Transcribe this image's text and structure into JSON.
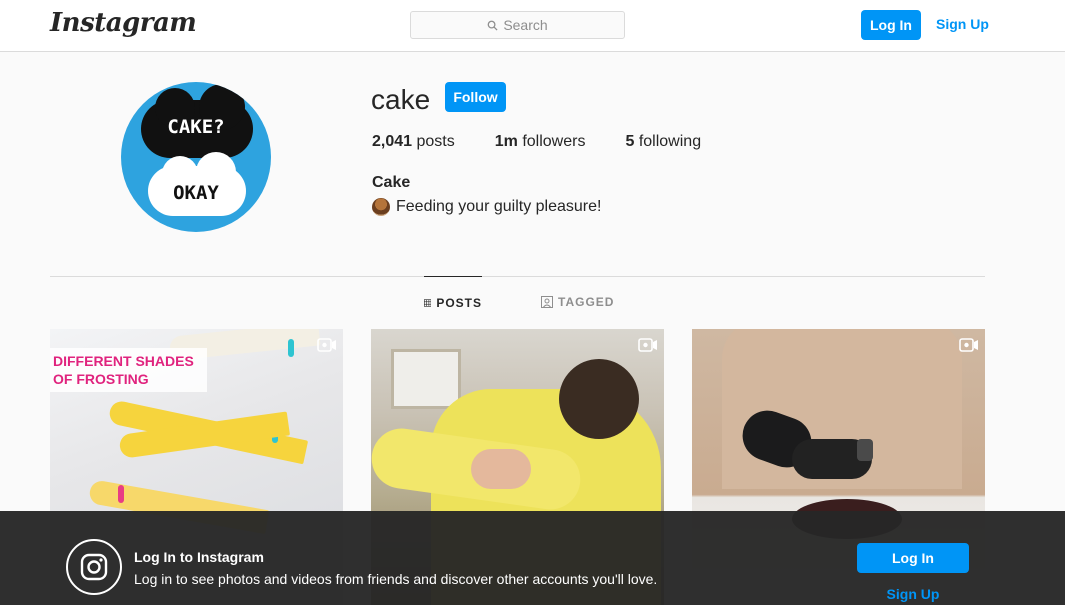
{
  "header": {
    "logo": "Instagram",
    "search_placeholder": "Search",
    "login_label": "Log In",
    "signup_label": "Sign Up"
  },
  "profile": {
    "avatar_top_text": "CAKE?",
    "avatar_bottom_text": "OKAY",
    "username": "cake",
    "follow_label": "Follow",
    "stats": [
      {
        "value": "2,041",
        "label": "posts"
      },
      {
        "value": "1m",
        "label": "followers"
      },
      {
        "value": "5",
        "label": "following"
      }
    ],
    "full_name": "Cake",
    "bio": "Feeding your guilty pleasure!",
    "bio_emoji_icon": "cake-icon"
  },
  "tabs": [
    {
      "label": "POSTS",
      "icon": "grid-icon",
      "active": true
    },
    {
      "label": "TAGGED",
      "icon": "tagged-icon",
      "active": false
    }
  ],
  "posts": [
    {
      "overlay_text_line1": "DIFFERENT SHADES",
      "overlay_text_line2": "OF FROSTING",
      "type": "video"
    },
    {
      "type": "video"
    },
    {
      "type": "video"
    }
  ],
  "banner": {
    "title": "Log In to Instagram",
    "text": "Log in to see photos and videos from friends and discover other accounts you'll love.",
    "login_label": "Log In",
    "signup_label": "Sign Up"
  },
  "colors": {
    "accent": "#0095f6",
    "banner_bg": "#262626",
    "frosting_label": "#e0237e"
  }
}
